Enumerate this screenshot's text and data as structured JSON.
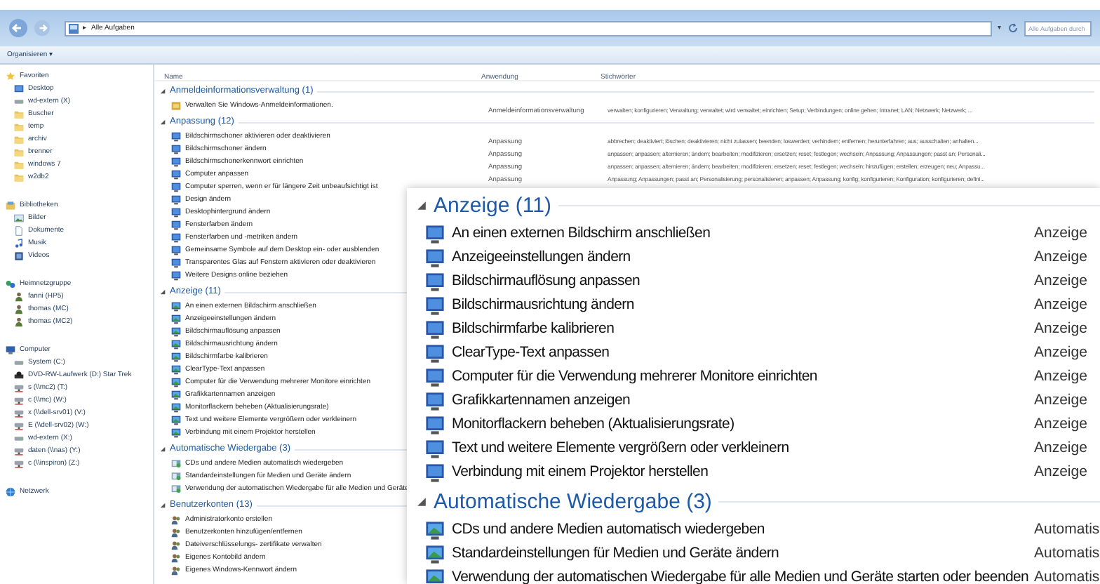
{
  "address_bar": {
    "separator": "▸",
    "location": "Alle Aufgaben"
  },
  "search": {
    "placeholder": "Alle Aufgaben durch"
  },
  "toolbar": {
    "organize": "Organisieren",
    "caret": "▾"
  },
  "nav": [
    {
      "label": "Favoriten",
      "children": [
        "Desktop",
        "wd-extern (X)",
        "Buscher",
        "temp",
        "archiv",
        "brenner",
        "windows 7",
        "w2db2"
      ]
    },
    {
      "label": "Bibliotheken",
      "children": [
        "Bilder",
        "Dokumente",
        "Musik",
        "Videos"
      ]
    },
    {
      "label": "Heimnetzgruppe",
      "children": [
        "fanni (HP5)",
        "thomas (MC)",
        "thomas (MC2)"
      ]
    },
    {
      "label": "Computer",
      "children": [
        "System (C:)",
        "DVD-RW-Laufwerk (D:) Star Trek",
        "s (\\\\mc2) (T:)",
        "c (\\\\mc) (W:)",
        "x (\\\\dell-srv01) (V:)",
        "E (\\\\dell-srv02) (W:)",
        "wd-extern (X:)",
        "daten (\\\\nas) (Y:)",
        "c (\\\\inspiron) (Z:)"
      ]
    },
    {
      "label": "Netzwerk"
    }
  ],
  "columns": [
    "Name",
    "Anwendung",
    "Stichwörter"
  ],
  "groups": [
    {
      "title": "Anmeldeinformationsverwaltung (1)",
      "expanded": true,
      "items": [
        {
          "name": "Verwalten Sie Windows-Anmeldeinformationen.",
          "application": "Anmeldeinformationsverwaltung",
          "keywords": "verwalten; konfigurieren; Verwaltung; verwaltet; wird verwaltet; einrichten; Setup; Verbindungen; online gehen; Intranet; LAN; Netzwerk; Netzwerk; ..."
        }
      ]
    },
    {
      "title": "Anpassung (12)",
      "expanded": true,
      "items": [
        {
          "name": "Bildschirmschoner aktivieren oder deaktivieren",
          "application": "Anpassung",
          "keywords": "abbrechen; deaktiviert; löschen; deaktivieren; nicht zulassen; beenden; loswerden; verhindern; entfernen; herunterfahren; aus; ausschalten; anhalten..."
        },
        {
          "name": "Bildschirmschoner ändern",
          "application": "Anpassung",
          "keywords": "anpassen; anpassen; alternieren; ändern; bearbeiten; modifizieren; ersetzen; reset; festlegen; wechseln; Anpassung; Anpassungen; passt an; Personali..."
        },
        {
          "name": "Bildschirmschonerkennwort einrichten",
          "application": "Anpassung",
          "keywords": "anpassen; anpassen; alternieren; ändern; bearbeiten; modifizieren; ersetzen; reset; festlegen; wechseln; hinzufügen; erstellen; erzeugen; neu; Anpassu..."
        },
        {
          "name": "Computer anpassen",
          "application": "Anpassung",
          "keywords": "Anpassung; Anpassungen; passt an; Personalisierung; personalisieren; anpassen; Anpassung; konfig; konfigurieren; Konfiguration; konfigurieren; defini..."
        },
        {
          "name": "Computer sperren, wenn er für längere Zeit unbeaufsichtigt ist"
        },
        {
          "name": "Design ändern"
        },
        {
          "name": "Desktophintergrund ändern"
        },
        {
          "name": "Fensterfarben ändern"
        },
        {
          "name": "Fensterfarben und -metriken ändern"
        },
        {
          "name": "Gemeinsame Symbole auf dem Desktop ein- oder ausblenden"
        },
        {
          "name": "Transparentes Glas auf Fenstern aktivieren oder deaktivieren"
        },
        {
          "name": "Weitere Designs online beziehen"
        }
      ]
    },
    {
      "title": "Anzeige (11)",
      "expanded": true,
      "items": [
        {
          "name": "An einen externen Bildschirm anschließen"
        },
        {
          "name": "Anzeigeeinstellungen ändern"
        },
        {
          "name": "Bildschirmauflösung anpassen"
        },
        {
          "name": "Bildschirmausrichtung ändern"
        },
        {
          "name": "Bildschirmfarbe kalibrieren"
        },
        {
          "name": "ClearType-Text anpassen"
        },
        {
          "name": "Computer für die Verwendung mehrerer Monitore einrichten"
        },
        {
          "name": "Grafikkartennamen anzeigen"
        },
        {
          "name": "Monitorflackern beheben (Aktualisierungsrate)"
        },
        {
          "name": "Text und weitere Elemente vergrößern oder verkleinern"
        },
        {
          "name": "Verbindung mit einem Projektor herstellen"
        }
      ]
    },
    {
      "title": "Automatische Wiedergabe (3)",
      "expanded": true,
      "items": [
        {
          "name": "CDs und andere Medien automatisch wiedergeben"
        },
        {
          "name": "Standardeinstellungen für Medien und Geräte ändern"
        },
        {
          "name": "Verwendung der automatischen Wiedergabe für alle Medien und Geräte"
        }
      ]
    },
    {
      "title": "Benutzerkonten (13)",
      "expanded": true,
      "items": [
        {
          "name": "Administratorkonto erstellen"
        },
        {
          "name": "Benutzerkonten hinzufügen/entfernen"
        },
        {
          "name": "Dateiverschlüsselungs- zertifikate verwalten"
        },
        {
          "name": "Eigenes Kontobild ändern"
        },
        {
          "name": "Eigenes Windows-Kennwort ändern"
        }
      ]
    }
  ],
  "magnifier": {
    "groups": [
      {
        "title": "Anzeige (11)",
        "expanded": true,
        "items": [
          {
            "name": "An einen externen Bildschirm anschließen",
            "application": "Anzeige"
          },
          {
            "name": "Anzeigeeinstellungen ändern",
            "application": "Anzeige"
          },
          {
            "name": "Bildschirmauflösung anpassen",
            "application": "Anzeige"
          },
          {
            "name": "Bildschirmausrichtung ändern",
            "application": "Anzeige"
          },
          {
            "name": "Bildschirmfarbe kalibrieren",
            "application": "Anzeige"
          },
          {
            "name": "ClearType-Text anpassen",
            "application": "Anzeige"
          },
          {
            "name": "Computer für die Verwendung mehrerer Monitore einrichten",
            "application": "Anzeige"
          },
          {
            "name": "Grafikkartennamen anzeigen",
            "application": "Anzeige"
          },
          {
            "name": "Monitorflackern beheben (Aktualisierungsrate)",
            "application": "Anzeige"
          },
          {
            "name": "Text und weitere Elemente vergrößern oder verkleinern",
            "application": "Anzeige"
          },
          {
            "name": "Verbindung mit einem Projektor herstellen",
            "application": "Anzeige"
          }
        ]
      },
      {
        "title": "Automatische Wiedergabe (3)",
        "expanded": true,
        "items": [
          {
            "name": "CDs und andere Medien automatisch wiedergeben",
            "application": "Automatis"
          },
          {
            "name": "Standardeinstellungen für Medien und Geräte ändern",
            "application": "Automatis"
          },
          {
            "name": "Verwendung der automatischen Wiedergabe für alle Medien und Geräte starten oder beenden",
            "application": "Automatis"
          }
        ]
      }
    ]
  }
}
